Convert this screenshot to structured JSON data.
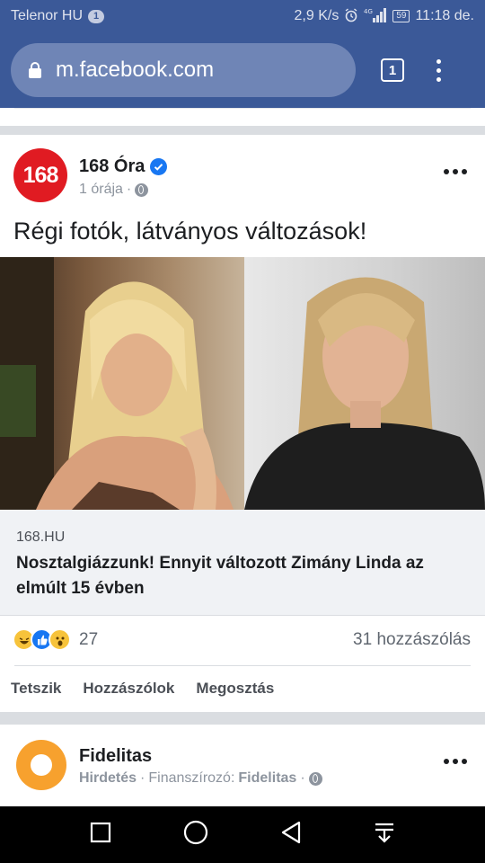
{
  "status_bar": {
    "carrier": "Telenor HU",
    "sim": "1",
    "speed": "2,9 K/s",
    "network": "4G",
    "battery": "59",
    "time": "11:18 de."
  },
  "browser": {
    "url": "m.facebook.com",
    "tab_count": "1"
  },
  "post": {
    "page_name": "168 Óra",
    "avatar_text": "168",
    "time": "1 órája",
    "text": "Régi fotók, látványos változások!",
    "link_domain": "168.HU",
    "link_title": "Nosztalgiázzunk! Ennyit változott Zimány Linda az elmúlt 15 évben",
    "reaction_count": "27",
    "comment_count": "31 hozzászólás",
    "actions": {
      "like": "Tetszik",
      "comment": "Hozzászólok",
      "share": "Megosztás"
    }
  },
  "ad": {
    "name": "Fidelitas",
    "label": "Hirdetés",
    "sponsor_prefix": "Finanszírozó:",
    "sponsor": "Fidelitas"
  },
  "colors": {
    "facebook_blue": "#3b5998",
    "verified": "#1877f2",
    "brand_168": "#e01b22",
    "fidelitas": "#f7a12e"
  }
}
